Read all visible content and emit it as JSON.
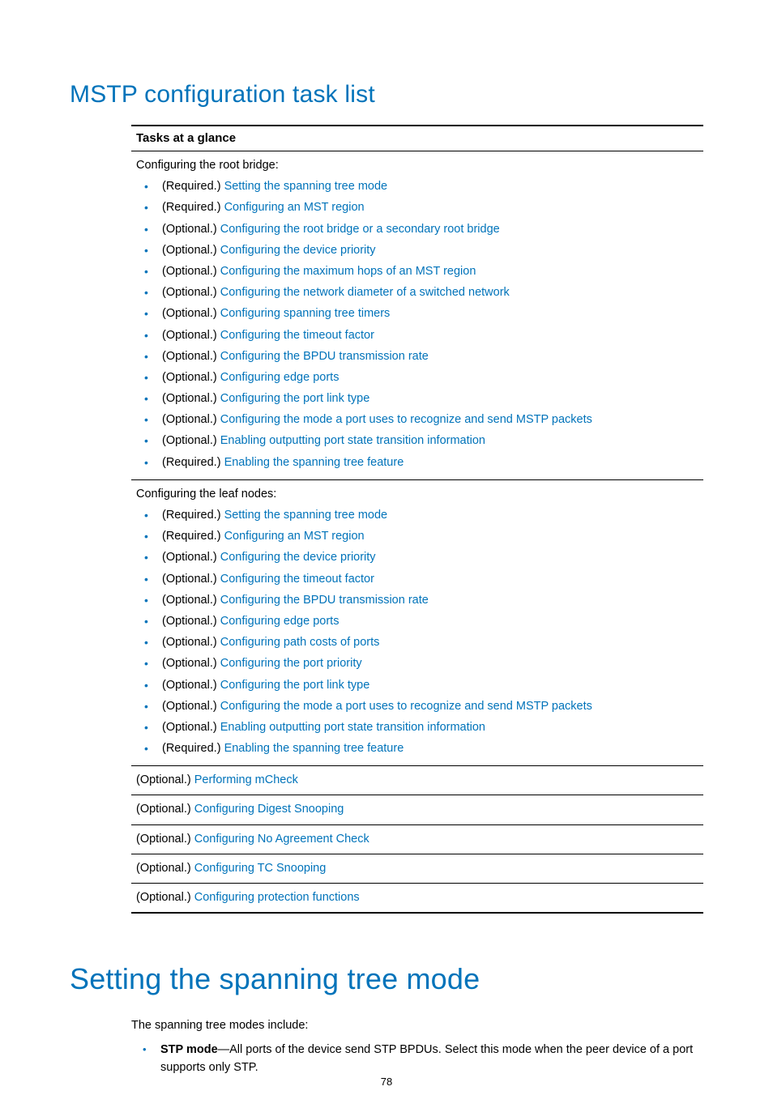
{
  "section1": {
    "title": "MSTP configuration task list"
  },
  "table": {
    "header": "Tasks at a glance",
    "root": {
      "intro": "Configuring the root bridge:",
      "items": [
        {
          "prefix": "(Required.) ",
          "link": "Setting the spanning tree mode"
        },
        {
          "prefix": "(Required.) ",
          "link": "Configuring an MST region"
        },
        {
          "prefix": "(Optional.) ",
          "link": "Configuring the root bridge or a secondary root bridge"
        },
        {
          "prefix": "(Optional.) ",
          "link": "Configuring the device priority"
        },
        {
          "prefix": "(Optional.) ",
          "link": "Configuring the maximum hops of an MST region"
        },
        {
          "prefix": "(Optional.) ",
          "link": "Configuring the network diameter of a switched network"
        },
        {
          "prefix": "(Optional.) ",
          "link": "Configuring spanning tree timers"
        },
        {
          "prefix": "(Optional.) ",
          "link": "Configuring the timeout factor"
        },
        {
          "prefix": "(Optional.) ",
          "link": "Configuring the BPDU transmission rate"
        },
        {
          "prefix": "(Optional.) ",
          "link": "Configuring edge ports"
        },
        {
          "prefix": "(Optional.) ",
          "link": "Configuring the port link type"
        },
        {
          "prefix": "(Optional.) ",
          "link": "Configuring the mode a port uses to recognize and send MSTP packets"
        },
        {
          "prefix": "(Optional.) ",
          "link": "Enabling outputting port state transition information"
        },
        {
          "prefix": "(Required.) ",
          "link": "Enabling the spanning tree feature"
        }
      ]
    },
    "leaf": {
      "intro": "Configuring the leaf nodes:",
      "items": [
        {
          "prefix": "(Required.) ",
          "link": "Setting the spanning tree mode"
        },
        {
          "prefix": "(Required.) ",
          "link": "Configuring an MST region"
        },
        {
          "prefix": "(Optional.) ",
          "link": "Configuring the device priority"
        },
        {
          "prefix": "(Optional.) ",
          "link": "Configuring the timeout factor"
        },
        {
          "prefix": "(Optional.) ",
          "link": "Configuring the BPDU transmission rate"
        },
        {
          "prefix": "(Optional.) ",
          "link": "Configuring edge ports"
        },
        {
          "prefix": "(Optional.) ",
          "link": "Configuring path costs of ports"
        },
        {
          "prefix": "(Optional.) ",
          "link": "Configuring the port priority"
        },
        {
          "prefix": "(Optional.) ",
          "link": "Configuring the port link type"
        },
        {
          "prefix": "(Optional.) ",
          "link": "Configuring the mode a port uses to recognize and send MSTP packets"
        },
        {
          "prefix": "(Optional.) ",
          "link": "Enabling outputting port state transition information"
        },
        {
          "prefix": "(Required.) ",
          "link": "Enabling the spanning tree feature"
        }
      ]
    },
    "rows": [
      {
        "prefix": "(Optional.) ",
        "link": "Performing mCheck"
      },
      {
        "prefix": "(Optional.) ",
        "link": "Configuring Digest Snooping"
      },
      {
        "prefix": "(Optional.) ",
        "link": "Configuring No Agreement Check"
      },
      {
        "prefix": "(Optional.) ",
        "link": "Configuring TC Snooping"
      },
      {
        "prefix": "(Optional.) ",
        "link": "Configuring protection functions"
      }
    ]
  },
  "section2": {
    "title": "Setting the spanning tree mode",
    "intro": "The spanning tree modes include:",
    "bullets": [
      {
        "bold": "STP mode",
        "text": "—All ports of the device send STP BPDUs. Select this mode when the peer device of a port supports only STP."
      }
    ]
  },
  "pagenum": "78"
}
